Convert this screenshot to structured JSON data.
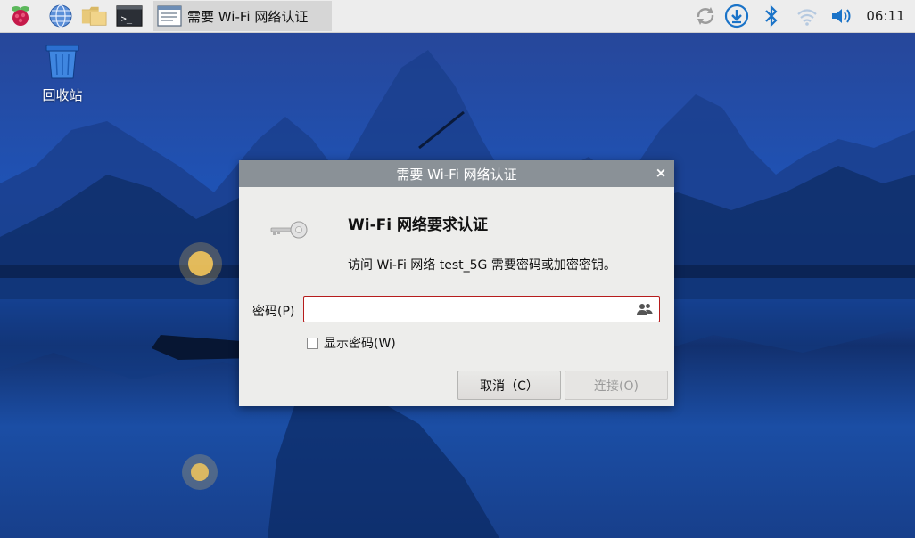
{
  "taskbar": {
    "launchers": [
      {
        "name": "raspberry-menu",
        "icon": "raspberry-icon"
      },
      {
        "name": "web-browser",
        "icon": "globe-icon"
      },
      {
        "name": "file-manager",
        "icon": "folder-icon"
      },
      {
        "name": "terminal",
        "icon": "terminal-icon"
      }
    ],
    "task_window_label": "需要 Wi-Fi 网络认证",
    "tray": [
      "sync-icon",
      "download-icon",
      "bluetooth-icon",
      "wifi-icon",
      "volume-icon"
    ],
    "clock": "06:11"
  },
  "desktop": {
    "trash_label": "回收站"
  },
  "dialog": {
    "title": "需要 Wi-Fi 网络认证",
    "close_glyph": "×",
    "heading": "Wi-Fi 网络要求认证",
    "description": "访问 Wi-Fi 网络 test_5G 需要密码或加密密钥。",
    "password_label": "密码(P)",
    "password_value": "",
    "show_password_label": "显示密码(W)",
    "show_password_checked": false,
    "cancel_label": "取消（C）",
    "connect_label": "连接(O)",
    "connect_enabled": false
  },
  "colors": {
    "titlebar": "#8a9197",
    "input_border_error": "#b61c1c",
    "tray_accent": "#1a73c8"
  }
}
